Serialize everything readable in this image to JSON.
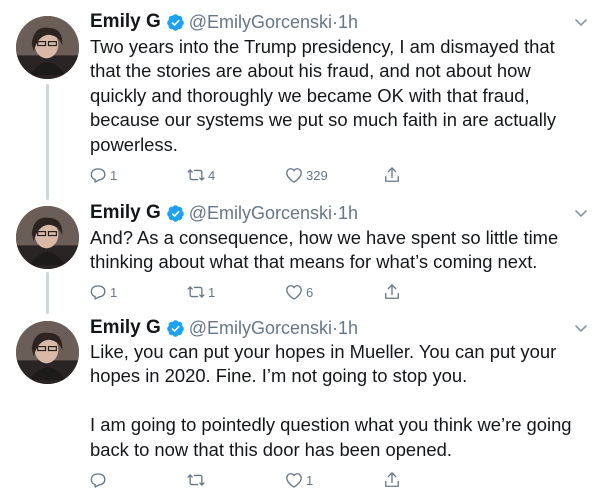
{
  "tweets": [
    {
      "name": "Emily G",
      "handle": "@EmilyGorcenski",
      "separator": "·",
      "time": "1h",
      "text": "Two years into the Trump presidency, I am dismayed that that the stories are about his fraud, and not about how quickly and thoroughly we became OK with that fraud, because our systems we put so much faith in are actually powerless.",
      "replies": "1",
      "retweets": "4",
      "likes": "329"
    },
    {
      "name": "Emily G",
      "handle": "@EmilyGorcenski",
      "separator": "·",
      "time": "1h",
      "text": "And? As a consequence, how we have spent so little time thinking about what that means for what’s coming next.",
      "replies": "1",
      "retweets": "1",
      "likes": "6"
    },
    {
      "name": "Emily G",
      "handle": "@EmilyGorcenski",
      "separator": "·",
      "time": "1h",
      "text": "Like, you can put your hopes in Mueller. You can put your hopes in 2020. Fine. I’m not going to stop you.\n\nI am going to pointedly question what you think we’re going back to now that this door has been opened.",
      "replies": "",
      "retweets": "",
      "likes": "1"
    }
  ],
  "icons": {
    "verified": "verified-badge-icon",
    "caret": "chevron-down-icon",
    "reply": "reply-icon",
    "retweet": "retweet-icon",
    "like": "heart-icon",
    "share": "share-icon"
  },
  "colors": {
    "verified": "#1da1f2",
    "text": "#14171a",
    "secondary": "#657786",
    "thread_line": "#cdd6dd"
  }
}
